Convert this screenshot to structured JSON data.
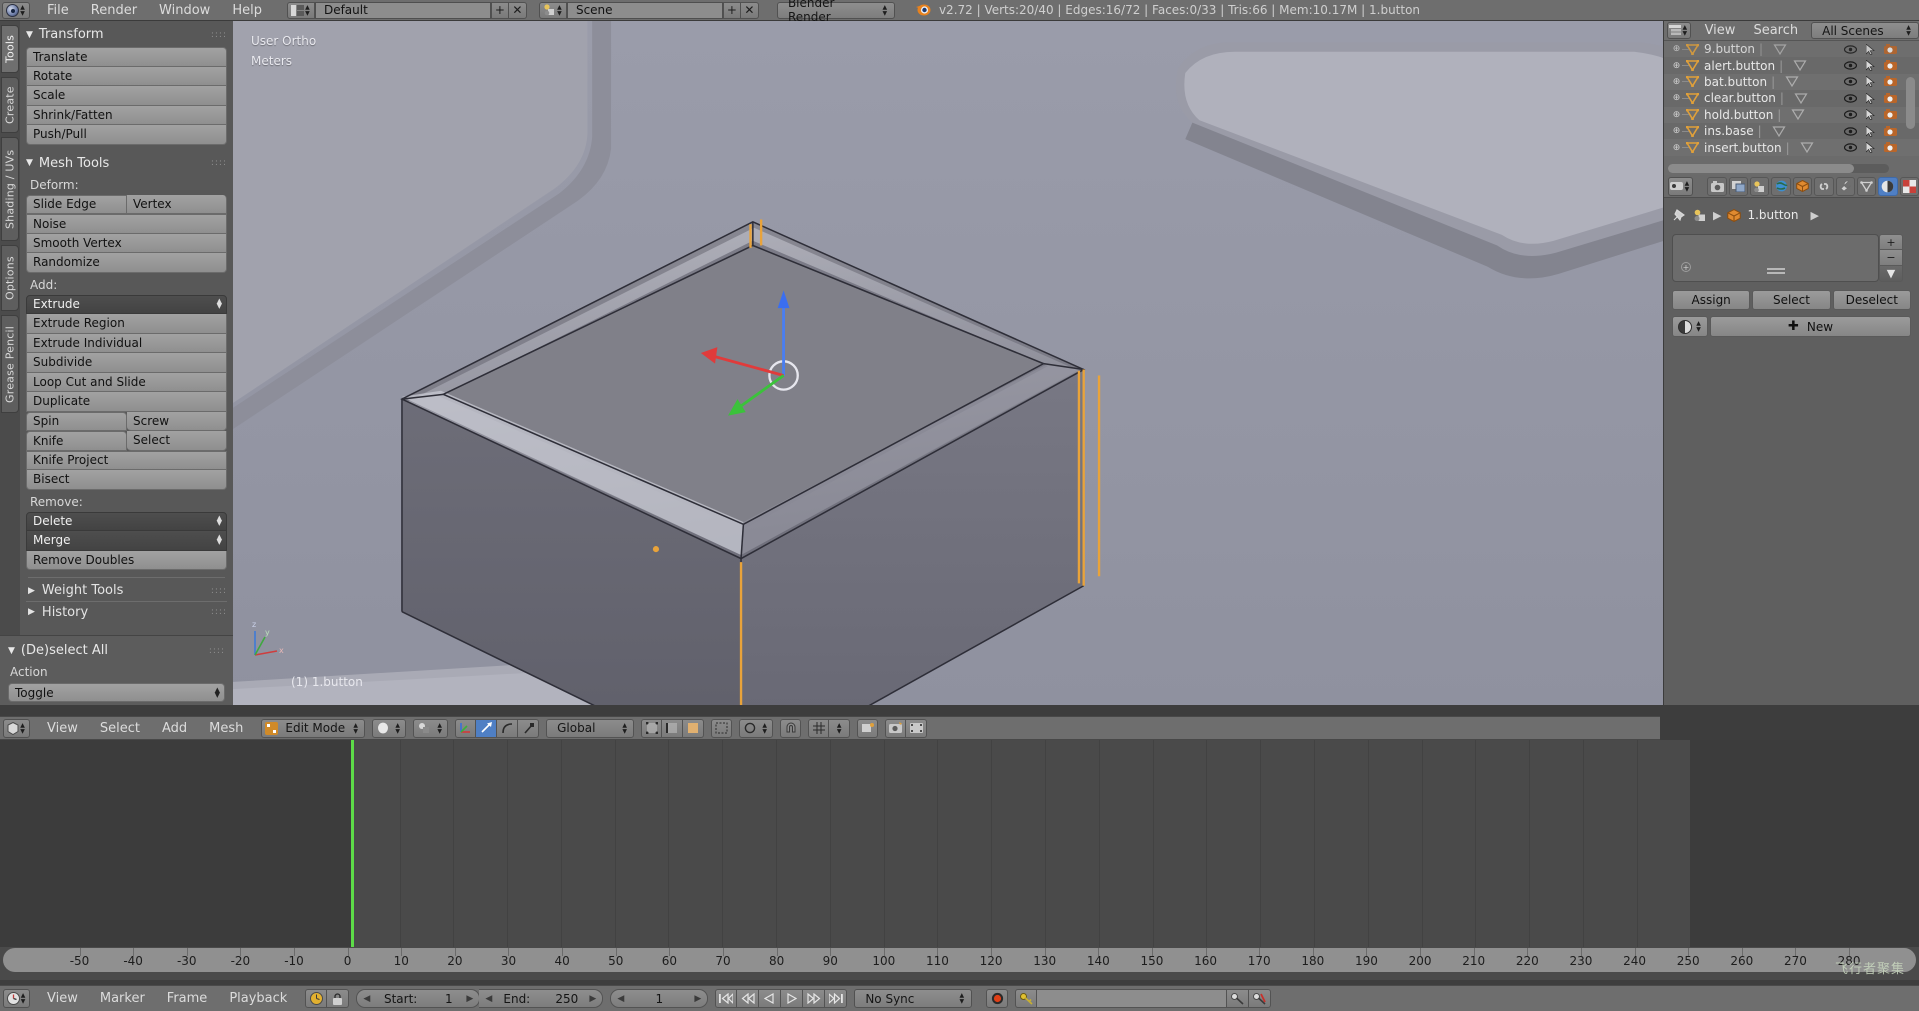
{
  "topbar": {
    "menus": [
      "File",
      "Render",
      "Window",
      "Help"
    ],
    "screen_layout": "Default",
    "scene": "Scene",
    "engine": "Blender Render",
    "stats": "v2.72 | Verts:20/40 | Edges:16/72 | Faces:0/33 | Tris:66 | Mem:10.17M | 1.button",
    "add_icon": "+",
    "close_icon": "✕"
  },
  "toolshelf": {
    "tabs": [
      {
        "label": "Tools",
        "active": true
      },
      {
        "label": "Create",
        "active": false
      },
      {
        "label": "Shading / UVs",
        "active": false
      },
      {
        "label": "Options",
        "active": false
      },
      {
        "label": "Grease Pencil",
        "active": false
      }
    ],
    "transform": {
      "title": "Transform",
      "buttons": [
        "Translate",
        "Rotate",
        "Scale",
        "Shrink/Fatten",
        "Push/Pull"
      ]
    },
    "mesh_tools": {
      "title": "Mesh Tools",
      "deform_label": "Deform:",
      "deform_rows": [
        [
          "Slide Edge",
          "Vertex"
        ],
        [
          "Noise"
        ],
        [
          "Smooth Vertex"
        ],
        [
          "Randomize"
        ]
      ],
      "add_label": "Add:",
      "add_rows": [
        [
          "Extrude"
        ],
        [
          "Extrude Region"
        ],
        [
          "Extrude Individual"
        ],
        [
          "Subdivide"
        ],
        [
          "Loop Cut and Slide"
        ],
        [
          "Duplicate"
        ],
        [
          "Spin",
          "Screw"
        ],
        [
          "Knife",
          "Select"
        ],
        [
          "Knife Project"
        ],
        [
          "Bisect"
        ]
      ],
      "remove_label": "Remove:",
      "remove_rows": [
        [
          "Delete"
        ],
        [
          "Merge"
        ],
        [
          "Remove Doubles"
        ]
      ]
    },
    "collapsed_panels": [
      "Weight Tools",
      "History"
    ],
    "deselect_all": {
      "title": "(De)select All",
      "action_label": "Action",
      "action_value": "Toggle"
    }
  },
  "viewport": {
    "view_mode": "User Ortho",
    "units": "Meters",
    "object_label": "(1) 1.button",
    "axis_labels": {
      "x": "x",
      "y": "y",
      "z": "z"
    }
  },
  "outliner": {
    "menus": [
      "View",
      "Search"
    ],
    "display_mode": "All Scenes",
    "rows": [
      {
        "name": "9.button"
      },
      {
        "name": "alert.button"
      },
      {
        "name": "bat.button"
      },
      {
        "name": "clear.button"
      },
      {
        "name": "hold.button"
      },
      {
        "name": "ins.base"
      },
      {
        "name": "insert.button"
      }
    ],
    "row_icons": [
      "eye-icon",
      "cursor-icon",
      "camera-icon"
    ]
  },
  "properties": {
    "tabs": [
      "render-icon",
      "render-layers-icon",
      "scene-icon",
      "world-icon",
      "object-icon",
      "constraints-icon",
      "modifiers-icon",
      "data-icon",
      "material-icon",
      "texture-icon"
    ],
    "active_tab_index": 8,
    "breadcrumb": {
      "pin": "pin-icon",
      "scene": "scene-icon",
      "object": "1.button"
    },
    "slot_list_placeholder": "",
    "buttons": [
      "Assign",
      "Select",
      "Deselect"
    ],
    "new_button": "New",
    "side_buttons": [
      "+",
      "−",
      "▼"
    ]
  },
  "view3d_header": {
    "menus": [
      "View",
      "Select",
      "Add",
      "Mesh"
    ],
    "mode": "Edit Mode",
    "orientation": "Global",
    "select_modes": [
      "vertex-select-icon",
      "edge-select-icon",
      "face-select-icon"
    ],
    "pivot_icon": "pivot-icon",
    "snap_icon": "magnet-icon",
    "manipulator_icons": [
      "translate-manipulator-icon",
      "rotate-manipulator-icon",
      "scale-manipulator-icon"
    ]
  },
  "timeline": {
    "menus": [
      "View",
      "Marker",
      "Frame",
      "Playback"
    ],
    "start_label": "Start:",
    "start_value": "1",
    "end_label": "End:",
    "end_value": "250",
    "current_frame": "1",
    "sync_mode": "No Sync",
    "transport_icons": [
      "jump-start-icon",
      "prev-keyframe-icon",
      "play-reverse-icon",
      "play-icon",
      "next-keyframe-icon",
      "jump-end-icon"
    ],
    "record_icon": "record-icon",
    "keying_set_value": "",
    "ruler_ticks": [
      -50,
      -40,
      -30,
      -20,
      -10,
      0,
      10,
      20,
      30,
      40,
      50,
      60,
      70,
      80,
      90,
      100,
      110,
      120,
      130,
      140,
      150,
      160,
      170,
      180,
      190,
      200,
      210,
      220,
      230,
      240,
      250,
      260,
      270,
      280
    ],
    "range_start": 1,
    "range_end": 250,
    "playhead_frame": 1
  },
  "watermark": {
    "text": "飞行者聚集"
  },
  "colors": {
    "accent_blue": "#4f7fc4",
    "playhead_green": "#5ddc48",
    "mesh_orange": "#e9a33a",
    "header_grey": "#6e6e6e",
    "panel_grey": "#585858",
    "viewport_bg": "#8f8f9e"
  }
}
